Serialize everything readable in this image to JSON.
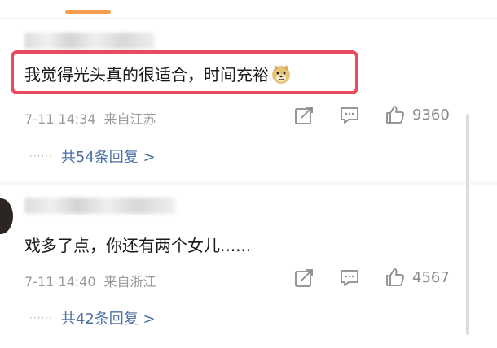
{
  "comments": [
    {
      "text": "我觉得光头真的很适合，时间充裕",
      "date": "7-11 14:34",
      "location": "来自江苏",
      "likes": "9360",
      "replies": "共54条回复 >",
      "emoji": "doge-emoji"
    },
    {
      "text": "戏多了点，你还有两个女儿......",
      "date": "7-11 14:40",
      "location": "来自浙江",
      "likes": "4567",
      "replies": "共42条回复 >"
    }
  ],
  "reply_dots": "······",
  "colors": {
    "accent_tab": "#f29e4c",
    "highlight_border": "#e84a5f",
    "reply_link": "#4a6fa5",
    "meta_text": "#9a9a9a"
  },
  "icons": [
    "share-icon",
    "comment-icon",
    "like-icon"
  ]
}
